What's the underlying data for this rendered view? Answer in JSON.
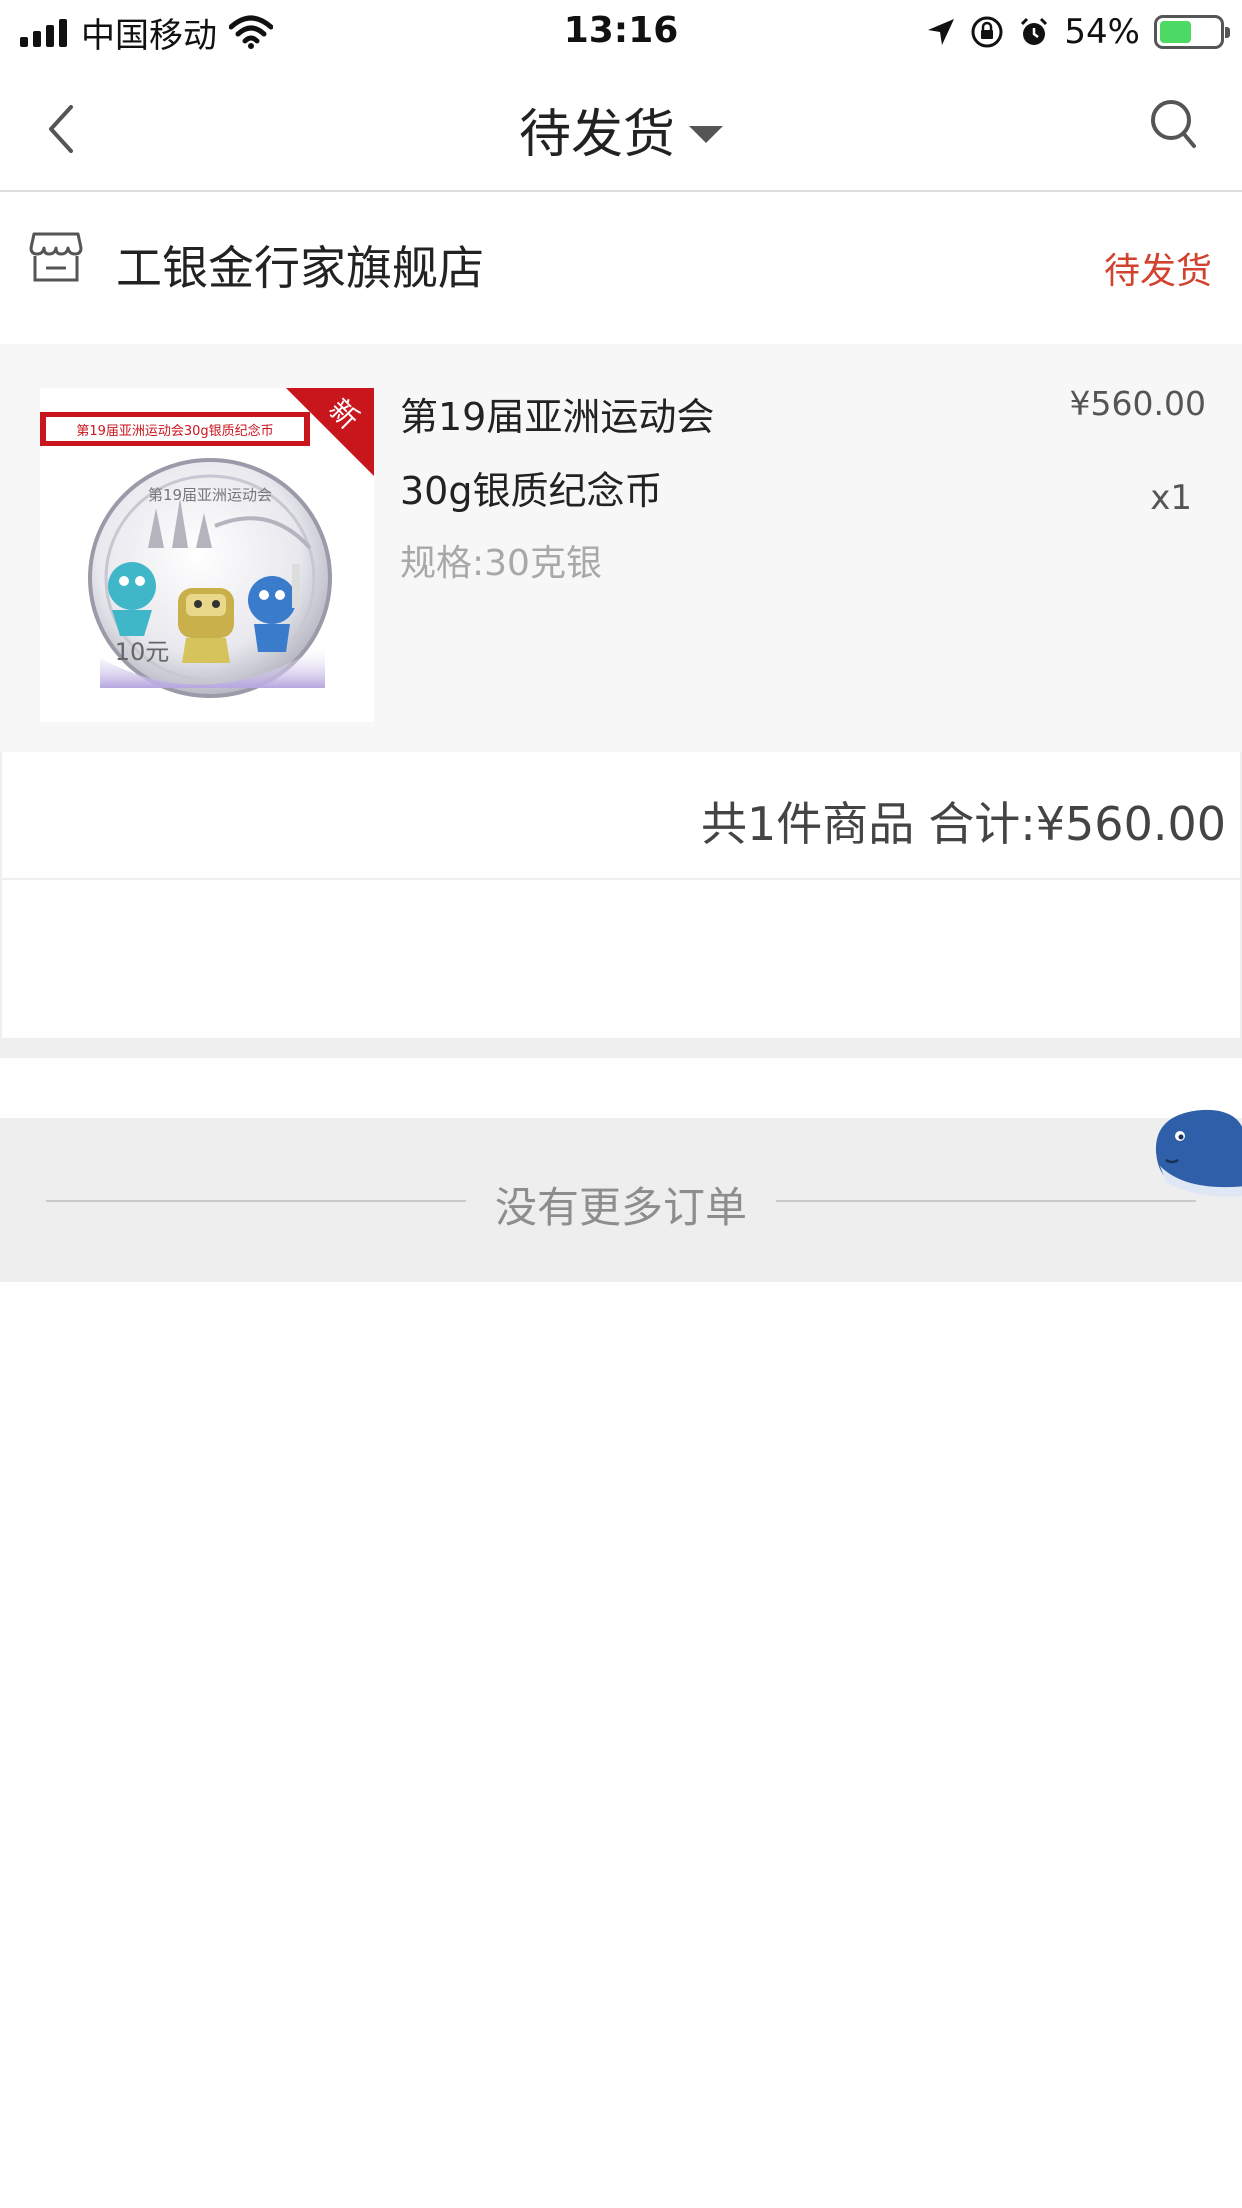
{
  "status_bar": {
    "carrier": "中国移动",
    "time": "13:16",
    "battery_percent": "54%",
    "battery_level": 0.54
  },
  "nav": {
    "title": "待发货",
    "back_icon": "chevron-left-icon",
    "search_icon": "search-icon",
    "dropdown_icon": "caret-down-icon"
  },
  "order": {
    "shop_name": "工银金行家旗舰店",
    "status": "待发货",
    "status_color": "#d1432f",
    "item": {
      "name": "第19届亚洲运动会30g银质纪念币",
      "spec": "规格:30克银",
      "price": "¥560.00",
      "quantity": "x1",
      "image": {
        "banner_text": "第19届亚洲运动会30g银质纪念币",
        "ribbon_text": "新",
        "coin_title": "第19届亚洲运动会",
        "coin_value": "10元"
      }
    },
    "summary": {
      "count_text": "共1件商品",
      "total_text": "合计:¥560.00"
    }
  },
  "list_end_text": "没有更多订单",
  "colors": {
    "accent_red": "#d1432f",
    "ribbon_red": "#c9161d",
    "background_gray": "#eeeeee"
  }
}
